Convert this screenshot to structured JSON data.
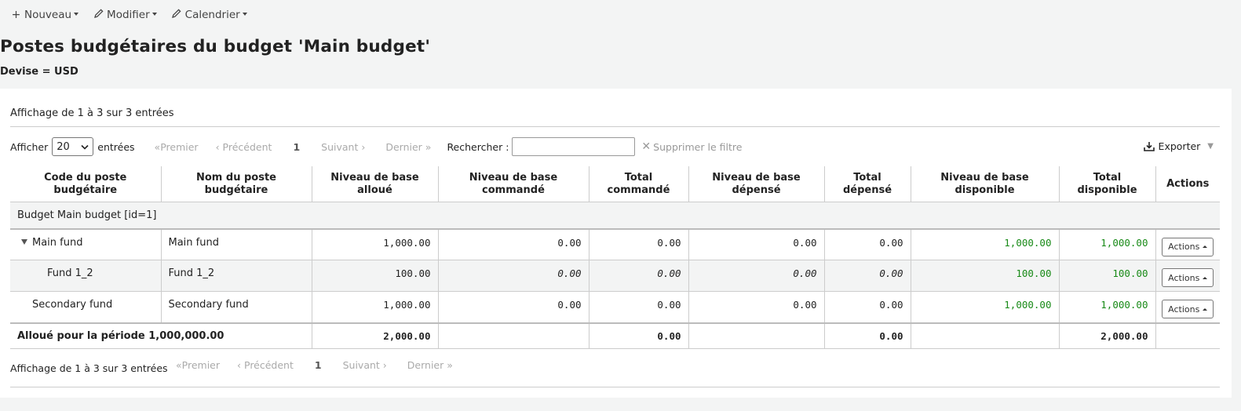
{
  "toolbar": {
    "new_label": "Nouveau",
    "modify_label": "Modifier",
    "calendar_label": "Calendrier"
  },
  "page": {
    "title": "Postes budgétaires du budget 'Main budget'",
    "currency": "Devise = USD"
  },
  "table_info": {
    "top": "Affichage de 1 à 3 sur 3 entrées",
    "bottom": "Affichage de 1 à 3 sur 3 entrées"
  },
  "controls": {
    "show_label": "Afficher",
    "page_size": "20",
    "entries_label": "entrées",
    "search_label": "Rechercher :",
    "search_value": "",
    "clear_filter": "Supprimer le filtre",
    "export_label": "Exporter"
  },
  "pager": {
    "first": "Premier",
    "prev": "Précédent",
    "current": "1",
    "next": "Suivant",
    "last": "Dernier"
  },
  "columns": [
    "Code du poste budgétaire",
    "Nom du poste budgétaire",
    "Niveau de base alloué",
    "Niveau de base commandé",
    "Total commandé",
    "Niveau de base dépensé",
    "Total dépensé",
    "Niveau de base disponible",
    "Total disponible",
    "Actions"
  ],
  "group_label": "Budget Main budget [id=1]",
  "rows": [
    {
      "code": "Main fund",
      "name": "Main fund",
      "allocated": "1,000.00",
      "ordered": "0.00",
      "total_ordered": "0.00",
      "spent": "0.00",
      "total_spent": "0.00",
      "available": "1,000.00",
      "total_available": "1,000.00",
      "action": "Actions"
    },
    {
      "code": "Fund 1_2",
      "name": "Fund 1_2",
      "allocated": "100.00",
      "ordered": "0.00",
      "total_ordered": "0.00",
      "spent": "0.00",
      "total_spent": "0.00",
      "available": "100.00",
      "total_available": "100.00",
      "action": "Actions"
    },
    {
      "code": "Secondary fund",
      "name": "Secondary fund",
      "allocated": "1,000.00",
      "ordered": "0.00",
      "total_ordered": "0.00",
      "spent": "0.00",
      "total_spent": "0.00",
      "available": "1,000.00",
      "total_available": "1,000.00",
      "action": "Actions"
    }
  ],
  "footer": {
    "label": "Alloué pour la période 1,000,000.00",
    "allocated": "2,000.00",
    "total_ordered": "0.00",
    "total_spent": "0.00",
    "total_available": "2,000.00"
  },
  "colors": {
    "available_green": "#188a17"
  }
}
